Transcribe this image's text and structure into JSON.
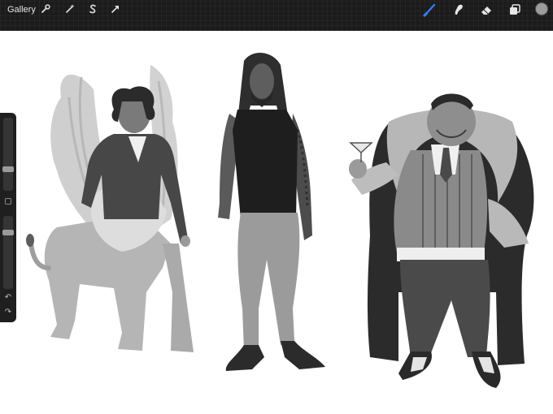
{
  "toolbar": {
    "gallery_label": "Gallery",
    "left_tools": [
      "wrench-icon",
      "magic-wand-icon",
      "selection-s-icon",
      "transform-arrow-icon"
    ],
    "right_tools": [
      "brush-icon",
      "smudge-icon",
      "eraser-icon",
      "layers-icon"
    ],
    "active_tool": "brush-icon",
    "active_color": "#2f7df6",
    "current_color": "#9c9c9c"
  },
  "sidebar": {
    "brush_size_level": 0.72,
    "opacity_level": 0.2,
    "icons": [
      "modify-square-icon",
      "undo-icon",
      "redo-icon"
    ],
    "undo_glyph": "↶",
    "redo_glyph": "↷"
  },
  "canvas": {
    "figures": [
      "winged-sphinx-figure",
      "tall-man-figure",
      "fur-coat-man-figure"
    ]
  }
}
